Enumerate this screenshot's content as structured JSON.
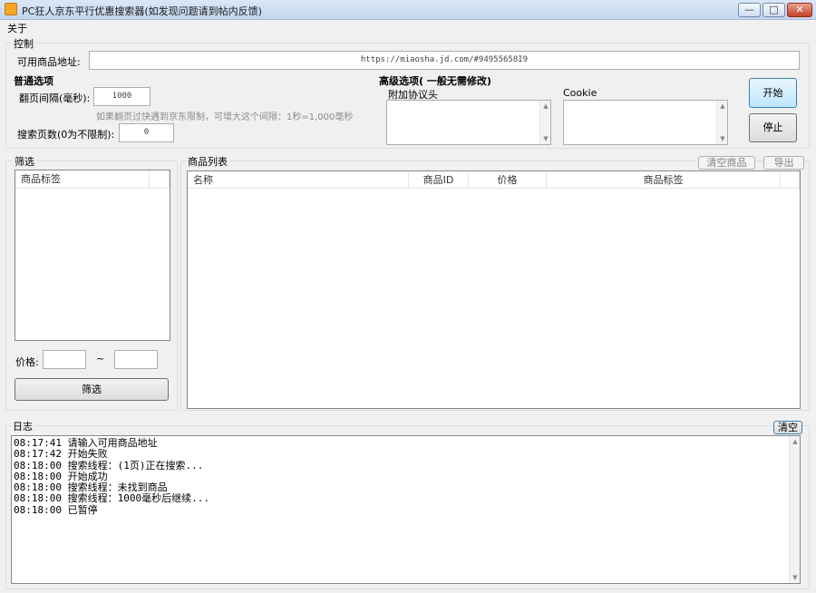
{
  "window": {
    "title": "PC狂人京东平行优惠搜索器(如发现问题请到帖内反馈)",
    "min_glyph": "—",
    "max_glyph": "□",
    "close_glyph": "✕"
  },
  "menu": {
    "about": "关于"
  },
  "control": {
    "group_label": "控制",
    "url_label": "可用商品地址:",
    "url_value": "https://miaosha.jd.com/#94955658I9",
    "basic_title": "普通选项",
    "interval_label": "翻页间隔(毫秒):",
    "interval_value": "1000",
    "interval_hint": "如果翻页过快遇到京东限制，可增大这个间隔：1秒=1,000毫秒",
    "pages_label": "搜索页数(0为不限制):",
    "pages_value": "0",
    "advanced_title": "高级选项( 一般无需修改)",
    "extra_protocol_label": "附加协议头",
    "cookie_label": "Cookie",
    "start_button": "开始",
    "stop_button": "停止"
  },
  "filter": {
    "group_label": "筛选",
    "tags_header": "商品标签",
    "price_label": "价格:",
    "price_sep": "~",
    "filter_button": "筛选"
  },
  "products": {
    "group_label": "商品列表",
    "clear_button": "清空商品",
    "export_button": "导出",
    "columns": [
      "名称",
      "商品ID",
      "价格",
      "商品标签"
    ]
  },
  "log": {
    "group_label": "日志",
    "clear_button": "清空",
    "lines": [
      "08:17:41 请输入可用商品地址",
      "08:17:42 开始失败",
      "08:18:00 搜索线程：(1页)正在搜索...",
      "08:18:00 开始成功",
      "08:18:00 搜索线程：未找到商品",
      "08:18:00 搜索线程：1000毫秒后继续...",
      "08:18:00 已暂停"
    ]
  }
}
